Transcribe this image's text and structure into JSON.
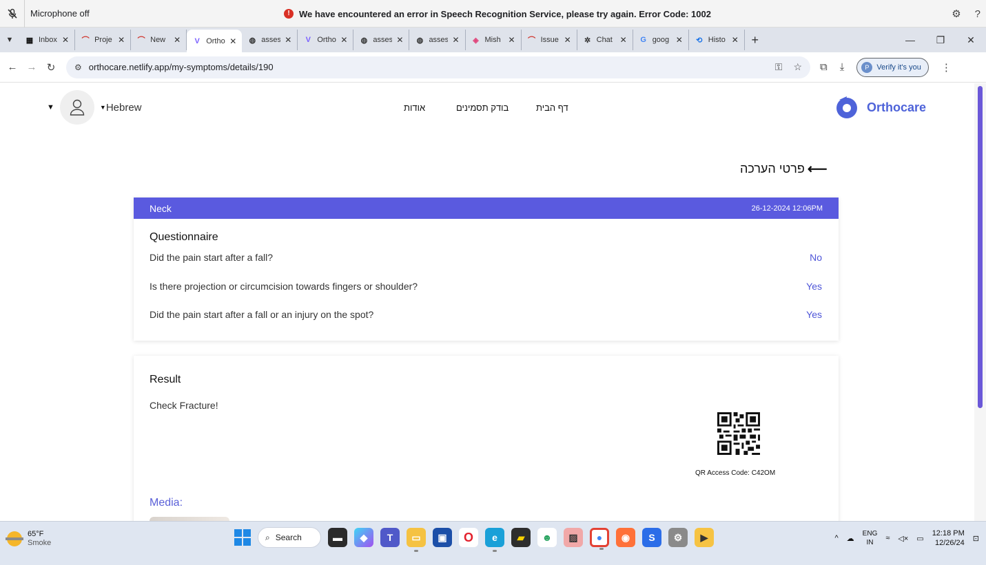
{
  "notification": {
    "mic_label": "Microphone off",
    "error_message": "We have encountered an error in Speech Recognition Service, please try again. Error Code: 1002",
    "help_label": "?"
  },
  "tabs": [
    {
      "icon": "inbox-icon",
      "label": "Inbox",
      "color": "#111111",
      "active": false
    },
    {
      "icon": "project-icon",
      "label": "Proje",
      "color": "#d0342c",
      "active": false
    },
    {
      "icon": "project-icon",
      "label": "New",
      "color": "#d0342c",
      "active": false
    },
    {
      "icon": "v-logo-icon",
      "label": "Ortho",
      "color": "#7b61ff",
      "active": true
    },
    {
      "icon": "globe-icon",
      "label": "asses",
      "color": "#333333",
      "active": false
    },
    {
      "icon": "v-logo-icon",
      "label": "Ortho",
      "color": "#7b61ff",
      "active": false
    },
    {
      "icon": "globe-icon",
      "label": "asses",
      "color": "#333333",
      "active": false
    },
    {
      "icon": "globe-icon",
      "label": "asses",
      "color": "#333333",
      "active": false
    },
    {
      "icon": "bot-icon",
      "label": "Mish",
      "color": "#e0457b",
      "active": false
    },
    {
      "icon": "project-icon",
      "label": "Issue",
      "color": "#d0342c",
      "active": false
    },
    {
      "icon": "chatgpt-icon",
      "label": "Chat",
      "color": "#333333",
      "active": false
    },
    {
      "icon": "google-icon",
      "label": "goog",
      "color": "#4285f4",
      "active": false
    },
    {
      "icon": "history-icon",
      "label": "Histo",
      "color": "#1a73e8",
      "active": false
    }
  ],
  "address_bar": {
    "url": "orthocare.netlify.app/my-symptoms/details/190",
    "verify_label": "Verify it's you",
    "avatar_letter": "P"
  },
  "site": {
    "brand": "Orthocare",
    "brand_color": "#4e63d9",
    "language": "Hebrew",
    "nav": [
      "אודות",
      "בודק תסמינים",
      "דף הבית"
    ],
    "page_title": "פרטי הערכה"
  },
  "questionnaire": {
    "body_part": "Neck",
    "date": "26-12-2024 12:06PM",
    "header_color": "#5a5adf",
    "title": "Questionnaire",
    "items": [
      {
        "question": "Did the pain start after a fall?",
        "answer": "No"
      },
      {
        "question": "Is there projection or circumcision towards fingers or shoulder?",
        "answer": "Yes"
      },
      {
        "question": "Did the pain start after a fall or an injury on the spot?",
        "answer": "Yes"
      }
    ]
  },
  "result": {
    "title": "Result",
    "text": "Check Fracture!",
    "qr_code_label": "QR Access Code: C42OM",
    "media_label": "Media:"
  },
  "taskbar": {
    "temperature": "65°F",
    "weather": "Smoke",
    "search_label": "Search",
    "lang_line1": "ENG",
    "lang_line2": "IN",
    "time": "12:18 PM",
    "date": "12/26/24"
  }
}
